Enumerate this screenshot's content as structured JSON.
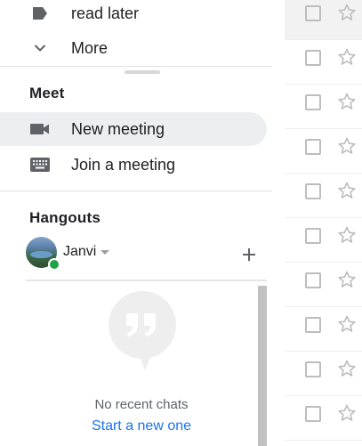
{
  "nav": {
    "items": [
      {
        "label": "read later",
        "icon": "label-icon"
      },
      {
        "label": "More",
        "icon": "chevron-down-icon"
      }
    ]
  },
  "meet": {
    "title": "Meet",
    "items": [
      {
        "label": "New meeting",
        "icon": "videocam-icon",
        "active": true
      },
      {
        "label": "Join a meeting",
        "icon": "keyboard-icon",
        "active": false
      }
    ]
  },
  "hangouts": {
    "title": "Hangouts",
    "user": {
      "name": "Janvi",
      "status": "online",
      "status_color": "#1ea446"
    },
    "empty_text": "No recent chats",
    "start_link": "Start a new one"
  },
  "mail_rows": 10,
  "colors": {
    "link": "#1a73e8",
    "active_bg": "#eceef1"
  }
}
